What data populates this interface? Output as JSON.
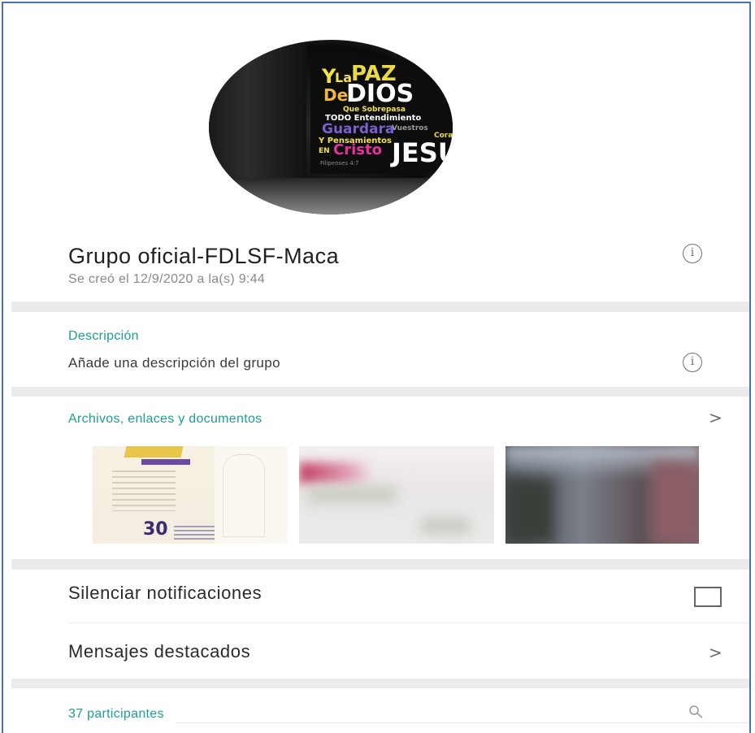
{
  "group": {
    "name": "Grupo oficial-FDLSF-Maca",
    "created": "Se creó el 12/9/2020 a la(s) 9:44"
  },
  "avatar_poster": {
    "lines": [
      "Y",
      "La",
      "PAZ",
      "De",
      "DIOS",
      "Que Sobrepasa",
      "TODO Entendimiento",
      "Guardara",
      "Vuestros",
      "Corazones",
      "Y Pensamientos",
      "EN",
      "Cristo",
      "JESUS",
      "Filipenses 4:7"
    ]
  },
  "description": {
    "label": "Descripción",
    "placeholder": "Añade una descripción del grupo"
  },
  "media": {
    "label": "Archivos, enlaces y documentos",
    "thumb_number": "30"
  },
  "settings": {
    "mute_label": "Silenciar notificaciones",
    "mute_checked": false,
    "starred_label": "Mensajes destacados"
  },
  "participants": {
    "label": "37 participantes"
  },
  "colors": {
    "accent": "#1e9e8e",
    "frame": "#4a72b8",
    "divider": "#ebebeb"
  },
  "icons": {
    "info": "info-icon",
    "chevron": "chevron-right-icon",
    "search": "search-icon"
  }
}
